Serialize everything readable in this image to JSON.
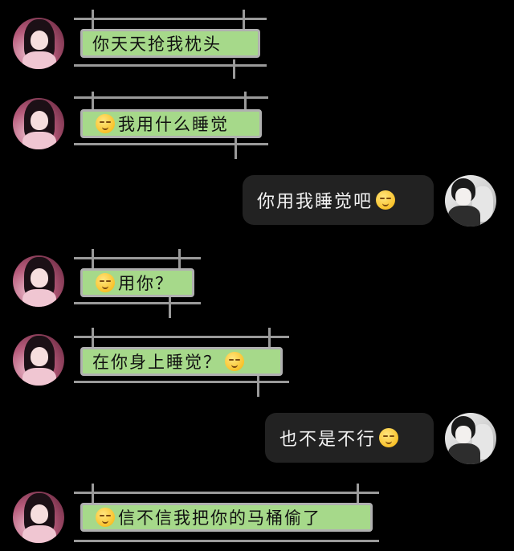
{
  "messages": [
    {
      "side": "left",
      "text": "你天天抢我枕头",
      "emoji_before": false,
      "emoji_after": false
    },
    {
      "side": "left",
      "text": "我用什么睡觉",
      "emoji_before": true,
      "emoji_after": false
    },
    {
      "side": "right",
      "text": "你用我睡觉吧",
      "emoji_before": false,
      "emoji_after": true
    },
    {
      "side": "left",
      "text": "用你？",
      "emoji_before": true,
      "emoji_after": false
    },
    {
      "side": "left",
      "text": "在你身上睡觉？",
      "emoji_before": false,
      "emoji_after": true
    },
    {
      "side": "right",
      "text": "也不是不行",
      "emoji_before": false,
      "emoji_after": true
    },
    {
      "side": "left",
      "text": "信不信我把你的马桶偷了",
      "emoji_before": true,
      "emoji_after": false
    }
  ],
  "icons": {
    "emoji": "smiling-face-emoji-icon",
    "left_avatar": "girl-avatar",
    "right_avatar": "boy-avatar"
  },
  "colors": {
    "background": "#000000",
    "left_bubble": "#a6d98a",
    "right_bubble": "#222222",
    "scaffold": "#9a9a9a"
  }
}
